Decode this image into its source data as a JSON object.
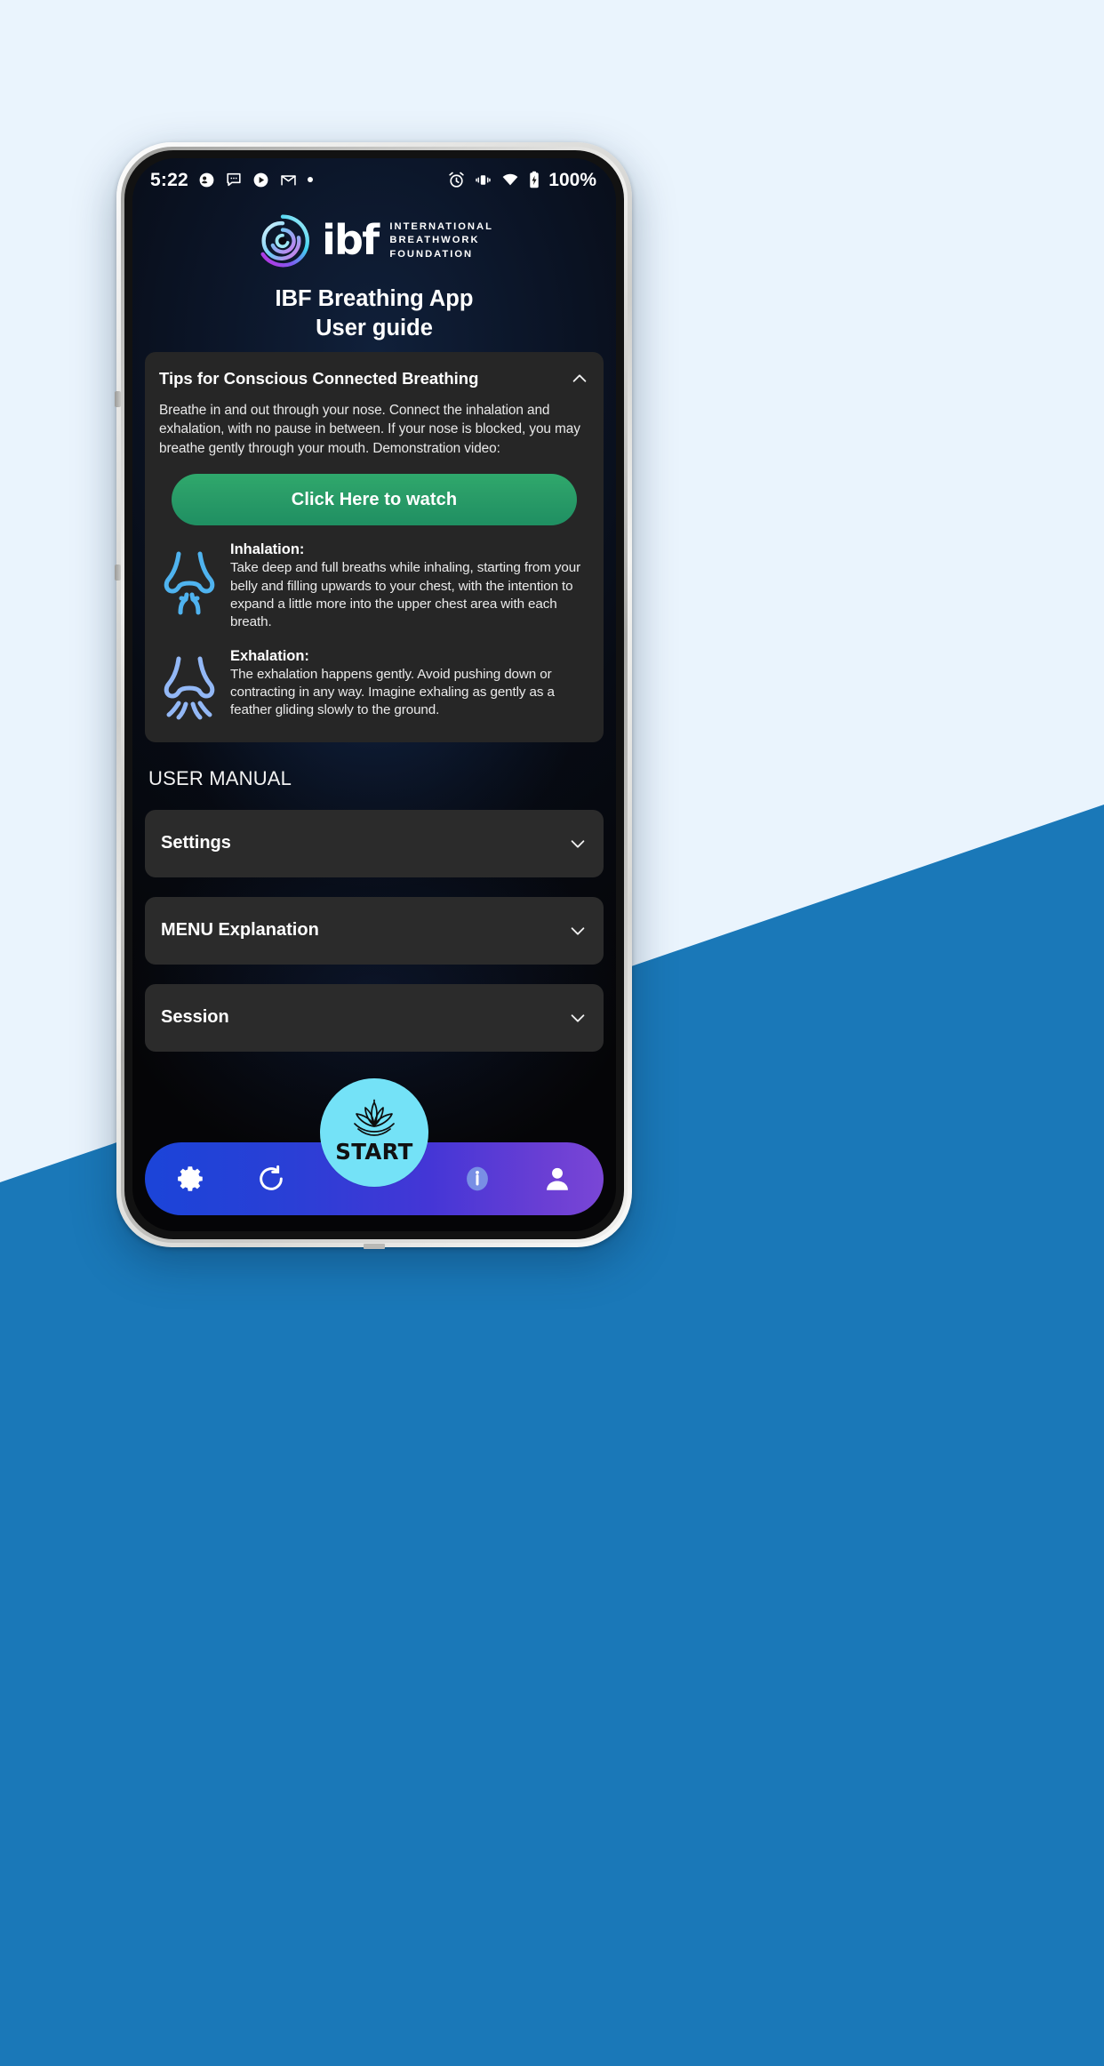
{
  "background": {
    "light_color": "#eaf4fd",
    "wedge_color": "#1a78b8"
  },
  "statusbar": {
    "time": "5:22",
    "left_icons": [
      "contacts-icon",
      "messages-icon",
      "play-icon",
      "gmail-icon",
      "more-dot-icon"
    ],
    "right_icons": [
      "alarm-icon",
      "vibrate-icon",
      "wifi-icon",
      "battery-charging-icon"
    ],
    "battery_text": "100%"
  },
  "header": {
    "logo_name": "ibf-spiral-logo",
    "wordmark": "ibf",
    "org_lines": [
      "INTERNATIONAL",
      "BREATHWORK",
      "FOUNDATION"
    ],
    "title_line1": "IBF Breathing App",
    "title_line2": "User guide"
  },
  "tips_card": {
    "title": "Tips for Conscious Connected Breathing",
    "chevron": "chevron-up-icon",
    "paragraph": "Breathe in and out through your nose. Connect the inhalation and exhalation, with no pause in between. If your nose is blocked, you may breathe gently through your mouth. Demonstration video:",
    "watch_button": "Click Here to watch",
    "watch_button_color": "#2a9d68",
    "breath_items": [
      {
        "icon": "nose-inhale-icon",
        "icon_color": "#4fb3ef",
        "title": "Inhalation:",
        "body": "Take deep and full breaths while inhaling, starting from your belly and filling upwards to your chest, with the intention to expand a little more into the upper chest area with each breath."
      },
      {
        "icon": "nose-exhale-icon",
        "icon_color": "#93b8f6",
        "title": "Exhalation:",
        "body": "The exhalation happens gently. Avoid pushing down or contracting in any way. Imagine  exhaling as gently as a feather gliding slowly to the ground."
      }
    ]
  },
  "user_manual": {
    "section_label": "USER MANUAL",
    "items": [
      {
        "label": "Settings",
        "chevron": "chevron-down-icon"
      },
      {
        "label": "MENU Explanation",
        "chevron": "chevron-down-icon"
      },
      {
        "label": "Session",
        "chevron": "chevron-down-icon"
      }
    ]
  },
  "bottom_nav": {
    "gradient_from": "#1b44d8",
    "gradient_to": "#7a46d6",
    "items": [
      {
        "name": "settings-gear-icon"
      },
      {
        "name": "refresh-icon"
      },
      {
        "name": "info-icon"
      },
      {
        "name": "profile-icon"
      }
    ],
    "start": {
      "label": "START",
      "icon": "lotus-icon",
      "color": "#74e2f7"
    }
  }
}
